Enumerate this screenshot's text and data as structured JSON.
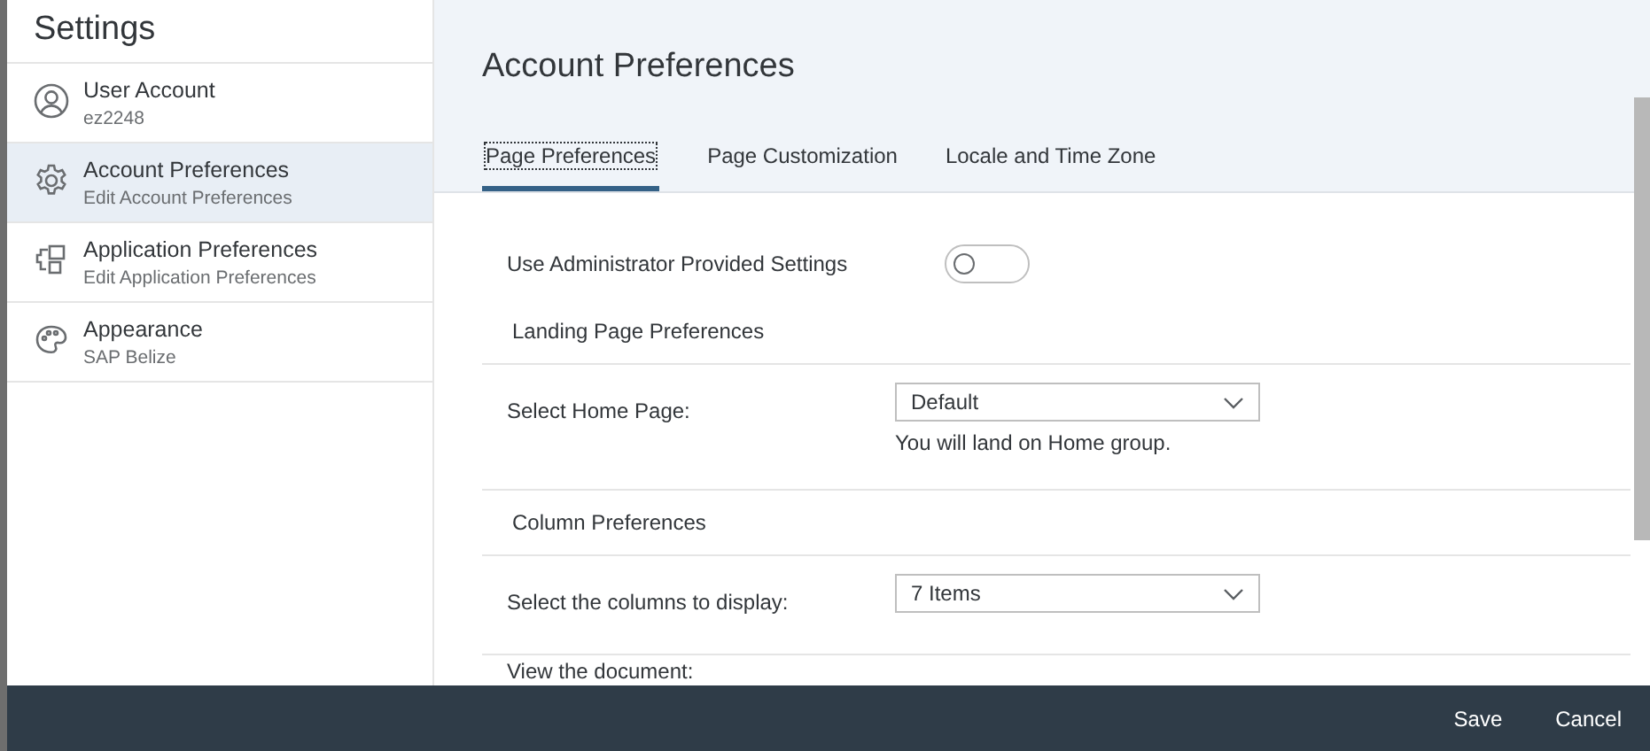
{
  "window": {
    "title": "Settings"
  },
  "sidebar": {
    "items": [
      {
        "kind": "user",
        "title": "User Account",
        "subtitle": "ez2248",
        "selected": false
      },
      {
        "kind": "gear",
        "title": "Account Preferences",
        "subtitle": "Edit Account Preferences",
        "selected": true
      },
      {
        "kind": "apps",
        "title": "Application Preferences",
        "subtitle": "Edit Application Preferences",
        "selected": false
      },
      {
        "kind": "palette",
        "title": "Appearance",
        "subtitle": "SAP Belize",
        "selected": false
      }
    ]
  },
  "page": {
    "title": "Account Preferences",
    "tabs": [
      {
        "label": "Page Preferences",
        "selected": true
      },
      {
        "label": "Page Customization",
        "selected": false
      },
      {
        "label": "Locale and Time Zone",
        "selected": false
      }
    ],
    "rows": [
      {
        "kind": "toggle",
        "label": "Use Administrator Provided Settings",
        "on": false
      },
      {
        "kind": "heading",
        "label": "Landing Page Preferences"
      },
      {
        "kind": "select",
        "label": "Select Home Page:",
        "value": "Default",
        "hint": "You will land on Home group."
      },
      {
        "kind": "heading",
        "label": "Column Preferences"
      },
      {
        "kind": "select",
        "label": "Select the columns to display:",
        "value": "7 Items"
      },
      {
        "kind": "label",
        "label": "View the document:"
      }
    ]
  },
  "footer": {
    "buttons": [
      "Save",
      "Cancel"
    ]
  }
}
